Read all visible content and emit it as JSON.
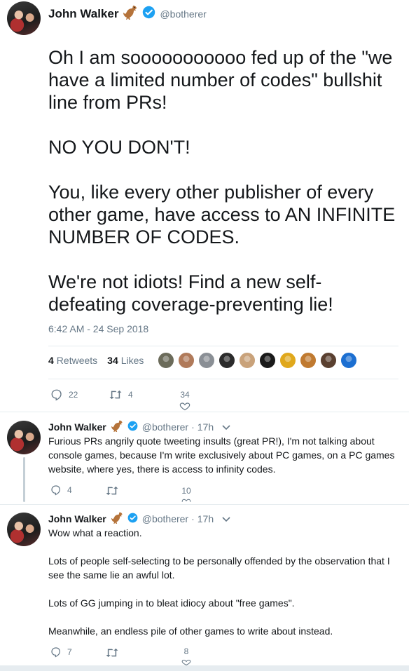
{
  "main_tweet": {
    "name": "John Walker",
    "handle": "@botherer",
    "text": "Oh I am sooooooooooo fed up of the \"we have a limited number of codes\" bullshit line from PRs!\n\nNO YOU DON'T!\n\nYou, like every other publisher of every other game, have access to AN INFINITE NUMBER OF CODES.\n\nWe're not idiots! Find a new self-defeating coverage-preventing lie!",
    "timestamp": "6:42 AM - 24 Sep 2018",
    "retweets_count": "4",
    "retweets_label": "Retweets",
    "likes_count": "34",
    "likes_label": "Likes",
    "reply_count": "22",
    "retweet_action_count": "4",
    "like_action_count": "34",
    "likers": [
      "#6b6b5a",
      "#b07a5a",
      "#8a8f95",
      "#2b2b2b",
      "#c9a27a",
      "#1a1a1a",
      "#e0a81c",
      "#c07a30",
      "#5a4030",
      "#1c6fd1"
    ]
  },
  "replies": [
    {
      "name": "John Walker",
      "handle": "@botherer",
      "time": "17h",
      "text": "Furious PRs angrily quote tweeting insults (great PR!), I'm not talking about console games, because I'm write exclusively about PC games, on a PC games website, where yes, there is access to infinity codes.",
      "reply_count": "4",
      "retweet_count": "",
      "like_count": "10"
    },
    {
      "name": "John Walker",
      "handle": "@botherer",
      "time": "17h",
      "text": "Wow what a reaction.\n\nLots of people self-selecting to be personally offended by the observation that I see the same lie an awful lot.\n\nLots of GG jumping in to bleat idiocy about \"free games\".\n\nMeanwhile, an endless pile of other games to write about instead.",
      "reply_count": "7",
      "retweet_count": "",
      "like_count": "8"
    }
  ],
  "colors": {
    "text": "#14171a",
    "secondary": "#657786",
    "verified": "#1da1f2",
    "divider": "#e6ecf0"
  },
  "icons": [
    "dinosaur-icon",
    "verified-badge-icon",
    "reply-icon",
    "retweet-icon",
    "heart-icon",
    "chevron-down-icon"
  ]
}
